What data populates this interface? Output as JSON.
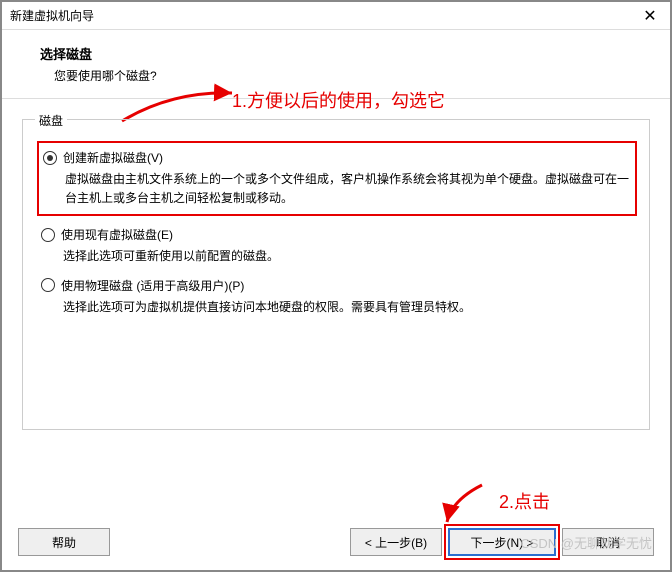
{
  "titlebar": {
    "title": "新建虚拟机向导"
  },
  "header": {
    "title": "选择磁盘",
    "subtitle": "您要使用哪个磁盘?"
  },
  "fieldset_label": "磁盘",
  "options": [
    {
      "label": "创建新虚拟磁盘(V)",
      "desc": "虚拟磁盘由主机文件系统上的一个或多个文件组成，客户机操作系统会将其视为单个硬盘。虚拟磁盘可在一台主机上或多台主机之间轻松复制或移动。",
      "checked": true
    },
    {
      "label": "使用现有虚拟磁盘(E)",
      "desc": "选择此选项可重新使用以前配置的磁盘。",
      "checked": false
    },
    {
      "label": "使用物理磁盘 (适用于高级用户)(P)",
      "desc": "选择此选项可为虚拟机提供直接访问本地硬盘的权限。需要具有管理员特权。",
      "checked": false
    }
  ],
  "annotations": {
    "a1": "1.方便以后的使用，勾选它",
    "a2": "2.点击"
  },
  "buttons": {
    "help": "帮助",
    "back": "< 上一步(B)",
    "next": "下一步(N) >",
    "cancel": "取消"
  },
  "watermark": "CSDN @无聊就学无忧"
}
